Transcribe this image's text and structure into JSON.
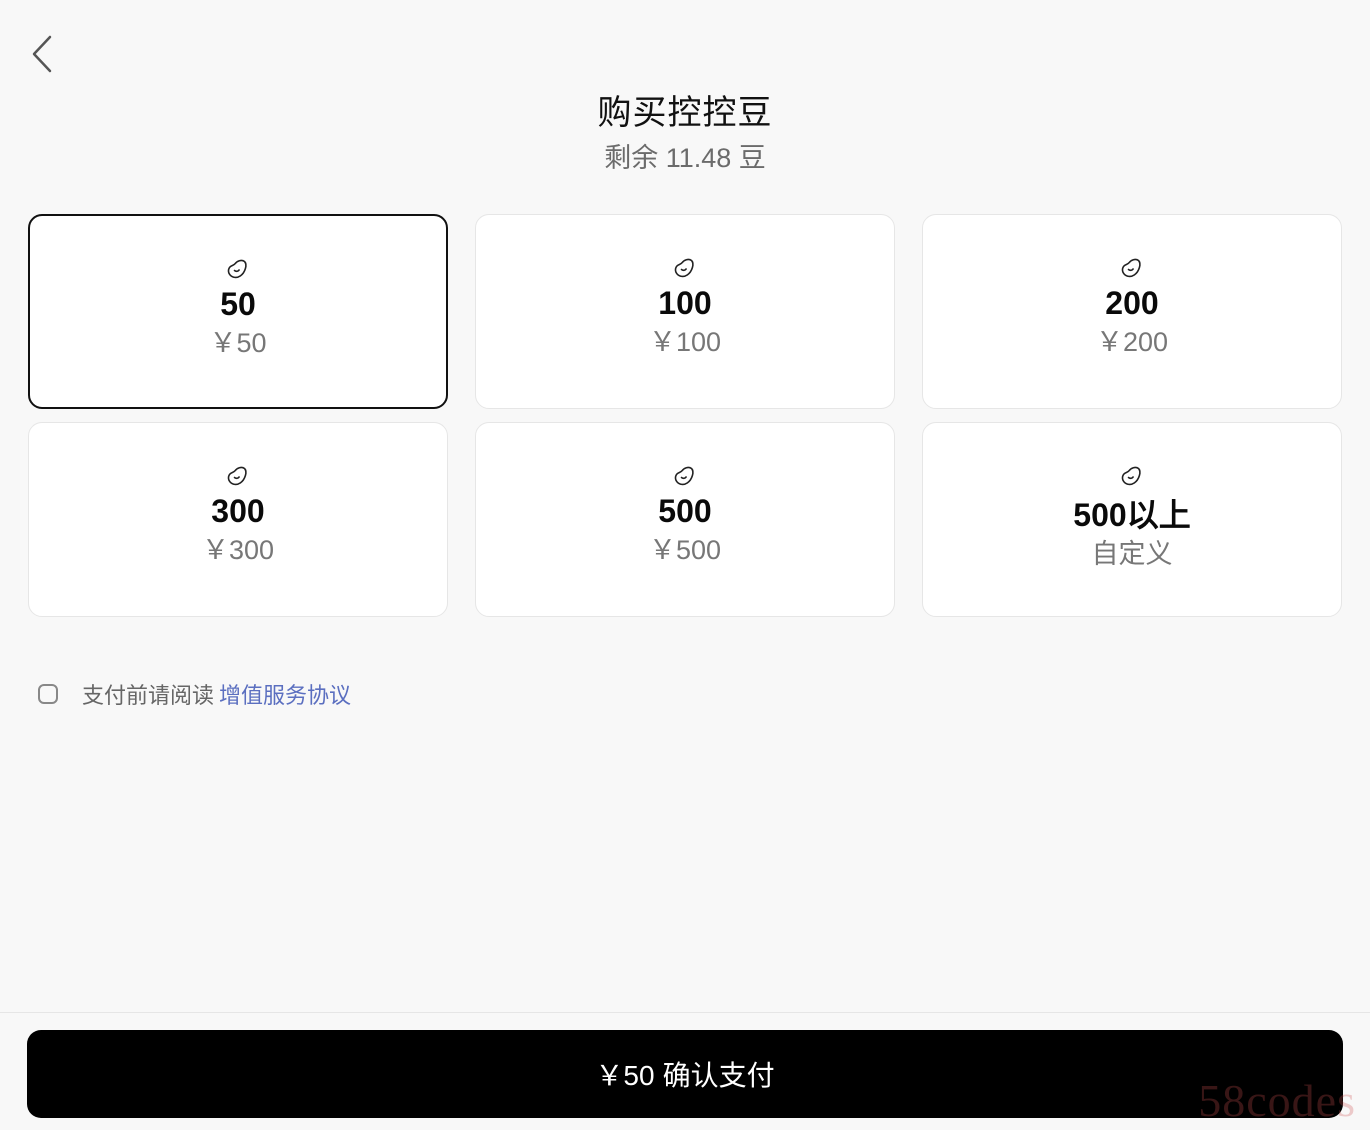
{
  "header": {
    "back_icon": "chevron-left-icon",
    "title": "购买控控豆",
    "balance": "剩余 11.48 豆"
  },
  "packages": [
    {
      "amount": "50",
      "price": "￥50",
      "selected": true,
      "icon": "bean-icon"
    },
    {
      "amount": "100",
      "price": "￥100",
      "selected": false,
      "icon": "bean-icon"
    },
    {
      "amount": "200",
      "price": "￥200",
      "selected": false,
      "icon": "bean-icon"
    },
    {
      "amount": "300",
      "price": "￥300",
      "selected": false,
      "icon": "bean-icon"
    },
    {
      "amount": "500",
      "price": "￥500",
      "selected": false,
      "icon": "bean-icon"
    },
    {
      "amount": "500以上",
      "price": "自定义",
      "selected": false,
      "icon": "bean-icon"
    }
  ],
  "agreement": {
    "checked": false,
    "text": "支付前请阅读",
    "link_text": "增值服务协议"
  },
  "footer": {
    "pay_price": "￥50",
    "pay_label": "确认支付"
  },
  "watermark": "58codes",
  "colors": {
    "background": "#f8f8f8",
    "selected_border": "#111111",
    "link": "#5b6fc0",
    "button": "#000000"
  }
}
